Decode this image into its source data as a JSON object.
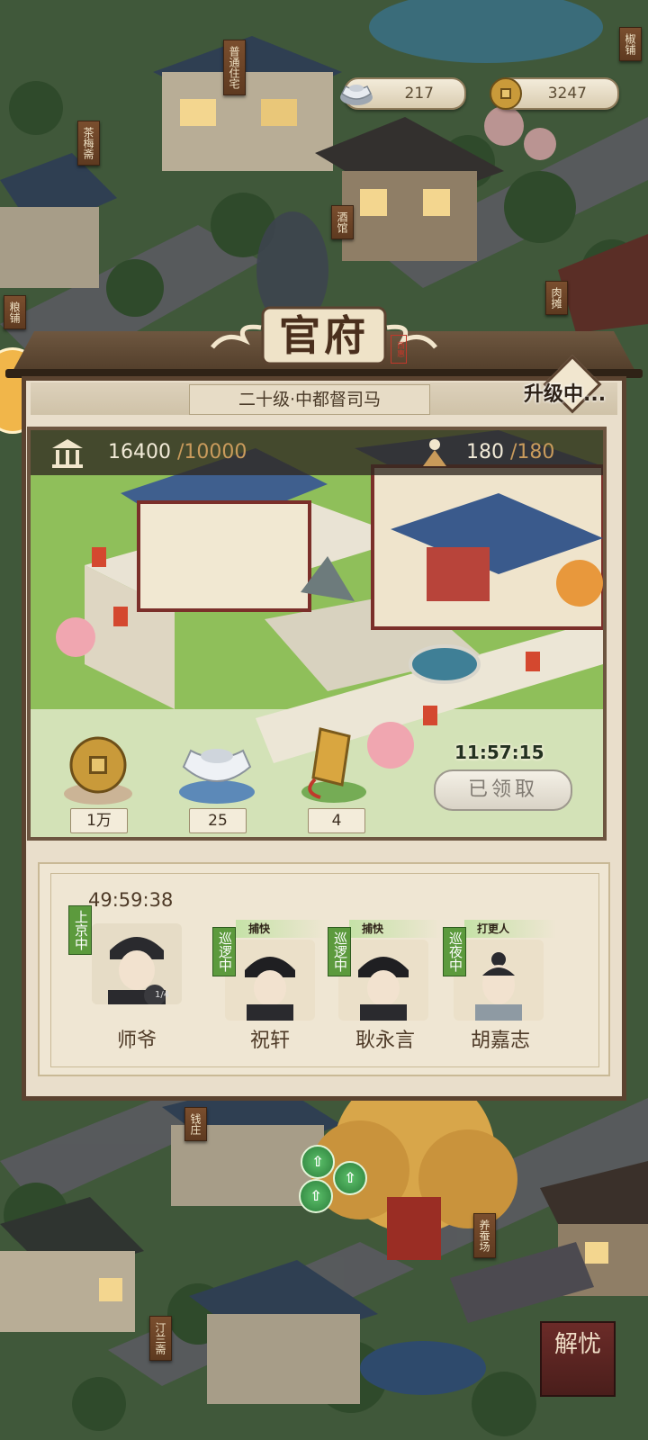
{
  "currency": {
    "silver": "217",
    "coins": "3247"
  },
  "signs": {
    "top_right": "椒铺",
    "top_center": "普通住宅",
    "left_upper": "茶梅斋",
    "center": "酒馆",
    "left_mid": "粮铺",
    "right_mid": "肉摊",
    "bottom_center": "钱庄",
    "bottom_right": "养蚕场",
    "bottom_left": "汀兰斋"
  },
  "panel": {
    "title": "官府",
    "seal": "西惠",
    "rank": "二十级·中都督司马",
    "upgrade_status": "升级中..."
  },
  "stats": {
    "prosperity_current": "16400",
    "prosperity_max": "/10000",
    "staff_current": "180",
    "staff_max": "/180"
  },
  "rewards": [
    {
      "icon": "copper-coin-icon",
      "label": "1万"
    },
    {
      "icon": "silver-ingot-icon",
      "label": "25"
    },
    {
      "icon": "token-icon",
      "label": "4"
    }
  ],
  "claim": {
    "timer": "11:57:15",
    "button_label": "已领取"
  },
  "staff": {
    "timer": "49:59:38",
    "members": [
      {
        "name": "师爷",
        "status": "上京中",
        "role": ""
      },
      {
        "name": "祝轩",
        "status": "巡逻中",
        "role": "捕快"
      },
      {
        "name": "耿永言",
        "status": "巡逻中",
        "role": "捕快"
      },
      {
        "name": "胡嘉志",
        "status": "巡夜中",
        "role": "打更人"
      }
    ],
    "portrait_badge": "1/4"
  },
  "bottom_button": "解忧",
  "colors": {
    "panel_bg": "#e9decb",
    "frame": "#5b4330",
    "status_green": "#5c9a3d"
  }
}
